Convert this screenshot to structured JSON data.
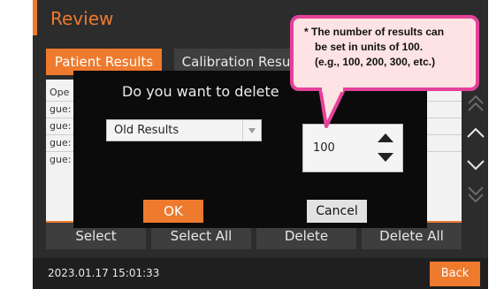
{
  "screen": {
    "title": "Review",
    "tabs": [
      {
        "label": "Patient Results",
        "active": true
      },
      {
        "label": "Calibration Resu",
        "active": false
      }
    ],
    "list_rows": [
      "Ope",
      "gue:",
      "gue:",
      "gue:",
      "gue:"
    ],
    "side_buttons": [
      "double-chevron-up-icon",
      "chevron-up-icon",
      "chevron-down-icon",
      "double-chevron-down-icon"
    ],
    "bottom_buttons": [
      "Select",
      "Select All",
      "Delete",
      "Delete All"
    ],
    "datetime": "2023.01.17  15:01:33",
    "back_label": "Back"
  },
  "dialog": {
    "question": "Do you want to delete",
    "select_value": "Old Results",
    "count_value": "100",
    "ok_label": "OK",
    "cancel_label": "Cancel"
  },
  "callout": {
    "lines": [
      "* The number of results can",
      "be set in units of 100.",
      "(e.g., 100, 200, 300, etc.)"
    ]
  },
  "colors": {
    "accent": "#ee7a2e",
    "callout_border": "#e5419a",
    "callout_fill": "#fde3e3"
  }
}
